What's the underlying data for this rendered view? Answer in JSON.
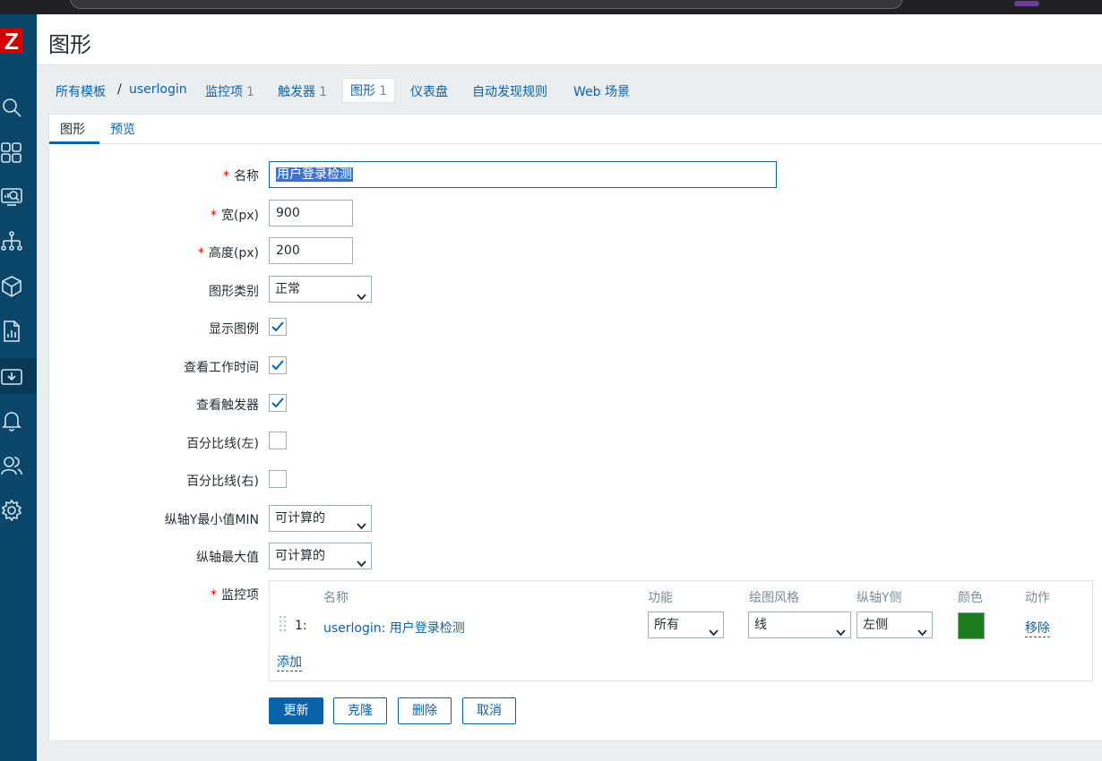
{
  "header": {
    "title": "图形"
  },
  "breadcrumb": {
    "all_templates": "所有模板",
    "separator": "/",
    "template": "userlogin",
    "items": {
      "label": "监控项",
      "count": "1"
    },
    "triggers": {
      "label": "触发器",
      "count": "1"
    },
    "graphs": {
      "label": "图形",
      "count": "1"
    },
    "dashboards": "仪表盘",
    "discovery": "自动发现规则",
    "web": "Web 场景"
  },
  "tabs": {
    "graph": "图形",
    "preview": "预览"
  },
  "form": {
    "name_label": "名称",
    "name_value": "用户登录检测",
    "width_label": "宽(px)",
    "width_value": "900",
    "height_label": "高度(px)",
    "height_value": "200",
    "graph_type_label": "图形类别",
    "graph_type_value": "正常",
    "show_legend_label": "显示图例",
    "show_legend": true,
    "show_work_period_label": "查看工作时间",
    "show_work_period": true,
    "show_triggers_label": "查看触发器",
    "show_triggers": true,
    "percentile_left_label": "百分比线(左)",
    "percentile_left": false,
    "percentile_right_label": "百分比线(右)",
    "percentile_right": false,
    "ymin_label": "纵轴Y最小值MIN",
    "ymin_value": "可计算的",
    "ymax_label": "纵轴最大值",
    "ymax_value": "可计算的",
    "items_label": "监控项"
  },
  "items_table": {
    "headers": {
      "name": "名称",
      "function": "功能",
      "draw_style": "绘图风格",
      "y_side": "纵轴Y侧",
      "color": "颜色",
      "action": "动作"
    },
    "rows": [
      {
        "index": "1:",
        "name": "userlogin: 用户登录检测",
        "function": "所有",
        "draw_style": "线",
        "y_side": "左侧",
        "color": "#1A7C1A",
        "action": "移除"
      }
    ],
    "add": "添加"
  },
  "buttons": {
    "update": "更新",
    "clone": "克隆",
    "delete": "删除",
    "cancel": "取消"
  },
  "colors": {
    "accent": "#0A62A8",
    "sidebar": "#0A466A",
    "required": "#D40000"
  }
}
